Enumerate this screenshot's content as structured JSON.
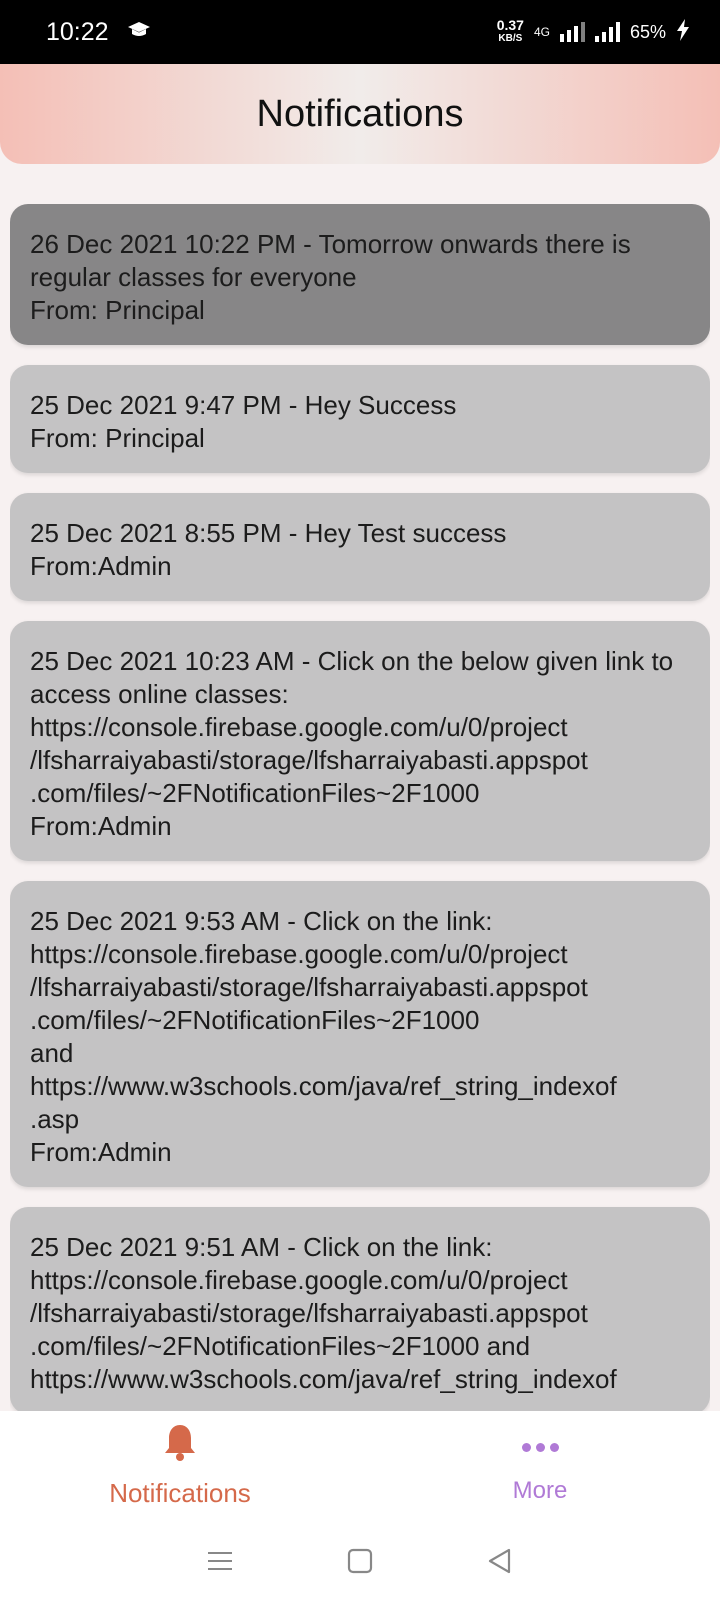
{
  "status_bar": {
    "time": "10:22",
    "speed_value": "0.37",
    "speed_unit": "KB/S",
    "network": "4G",
    "battery": "65%"
  },
  "header": {
    "title": "Notifications"
  },
  "notifications": [
    {
      "text": "26 Dec 2021 10:22 PM - Tomorrow onwards there is regular classes for everyone\nFrom: Principal"
    },
    {
      "text": "25 Dec 2021 9:47 PM - Hey Success\nFrom: Principal"
    },
    {
      "text": "25 Dec 2021 8:55 PM - Hey Test success\nFrom:Admin"
    },
    {
      "text": "25 Dec 2021 10:23 AM - Click on the below given link to access online classes:\nhttps://console.firebase.google.com/u/0/project\n/lfsharraiyabasti/storage/lfsharraiyabasti.appspot\n.com/files/~2FNotificationFiles~2F1000\nFrom:Admin"
    },
    {
      "text": "25 Dec 2021 9:53 AM - Click on the link:\nhttps://console.firebase.google.com/u/0/project\n/lfsharraiyabasti/storage/lfsharraiyabasti.appspot\n.com/files/~2FNotificationFiles~2F1000\nand\nhttps://www.w3schools.com/java/ref_string_indexof\n.asp\nFrom:Admin"
    },
    {
      "text": "25 Dec 2021 9:51 AM - Click on the link:\nhttps://console.firebase.google.com/u/0/project\n/lfsharraiyabasti/storage/lfsharraiyabasti.appspot\n.com/files/~2FNotificationFiles~2F1000 and\nhttps://www.w3schools.com/java/ref_string_indexof"
    }
  ],
  "bottom_nav": {
    "notifications_label": "Notifications",
    "more_label": "More",
    "active_color": "#d5694a",
    "more_color": "#b07ad6"
  }
}
